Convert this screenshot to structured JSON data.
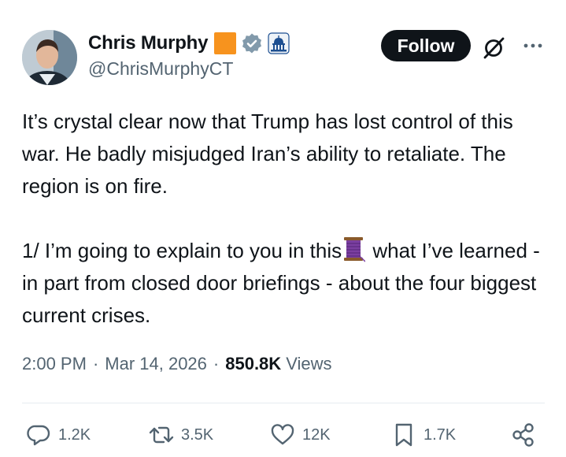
{
  "author": {
    "name": "Chris Murphy",
    "handle": "@ChrisMurphyCT"
  },
  "follow_label": "Follow",
  "tweet": {
    "paragraph1": "It’s crystal clear now that Trump has lost control of this war. He badly misjudged Iran’s ability to retaliate. The region is on fire.",
    "paragraph2_before": "1/ I’m going to explain to you in this",
    "paragraph2_after": " what I’ve learned - in part from closed door briefings - about the four biggest current crises."
  },
  "meta": {
    "time": "2:00 PM",
    "date": "Mar 14, 2026",
    "views_count": "850.8K",
    "views_label": "Views"
  },
  "actions": {
    "replies": "1.2K",
    "reposts": "3.5K",
    "likes": "12K",
    "bookmarks": "1.7K"
  },
  "colors": {
    "text": "#0f1419",
    "secondary": "#536471",
    "verified_badge": "#829aab",
    "affiliate_square": "#f7931e",
    "thread_emoji": "#7b3fa0"
  },
  "icons": {
    "verified": "verified-badge-icon",
    "affiliation": "capitol-icon",
    "grok": "grok-icon",
    "more": "more-icon",
    "reply": "reply-icon",
    "repost": "repost-icon",
    "like": "like-icon",
    "bookmark": "bookmark-icon",
    "share": "share-icon",
    "thread": "thread-spool-emoji"
  }
}
